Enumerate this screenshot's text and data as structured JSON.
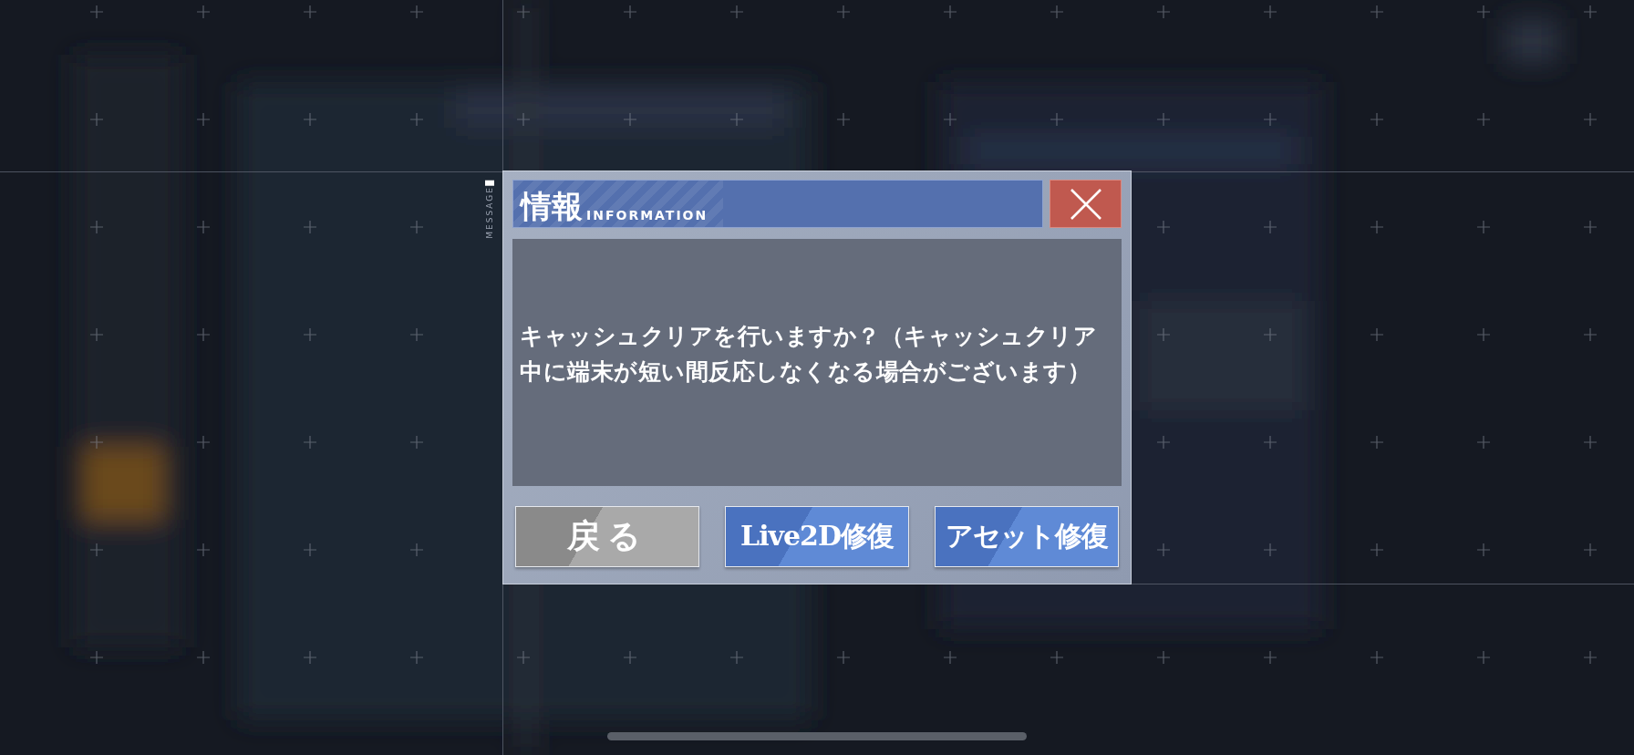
{
  "dialog": {
    "side_label": "MESSAGE",
    "title": "情報",
    "subtitle": "INFORMATION",
    "message": "キャッシュクリアを行いますか？（キャッシュクリア中に端末が短い間反応しなくなる場合がございます）",
    "buttons": [
      {
        "label": "戻る",
        "kind": "secondary"
      },
      {
        "label": "Live2D修復",
        "kind": "primary"
      },
      {
        "label": "アセット修復",
        "kind": "primary"
      }
    ]
  }
}
